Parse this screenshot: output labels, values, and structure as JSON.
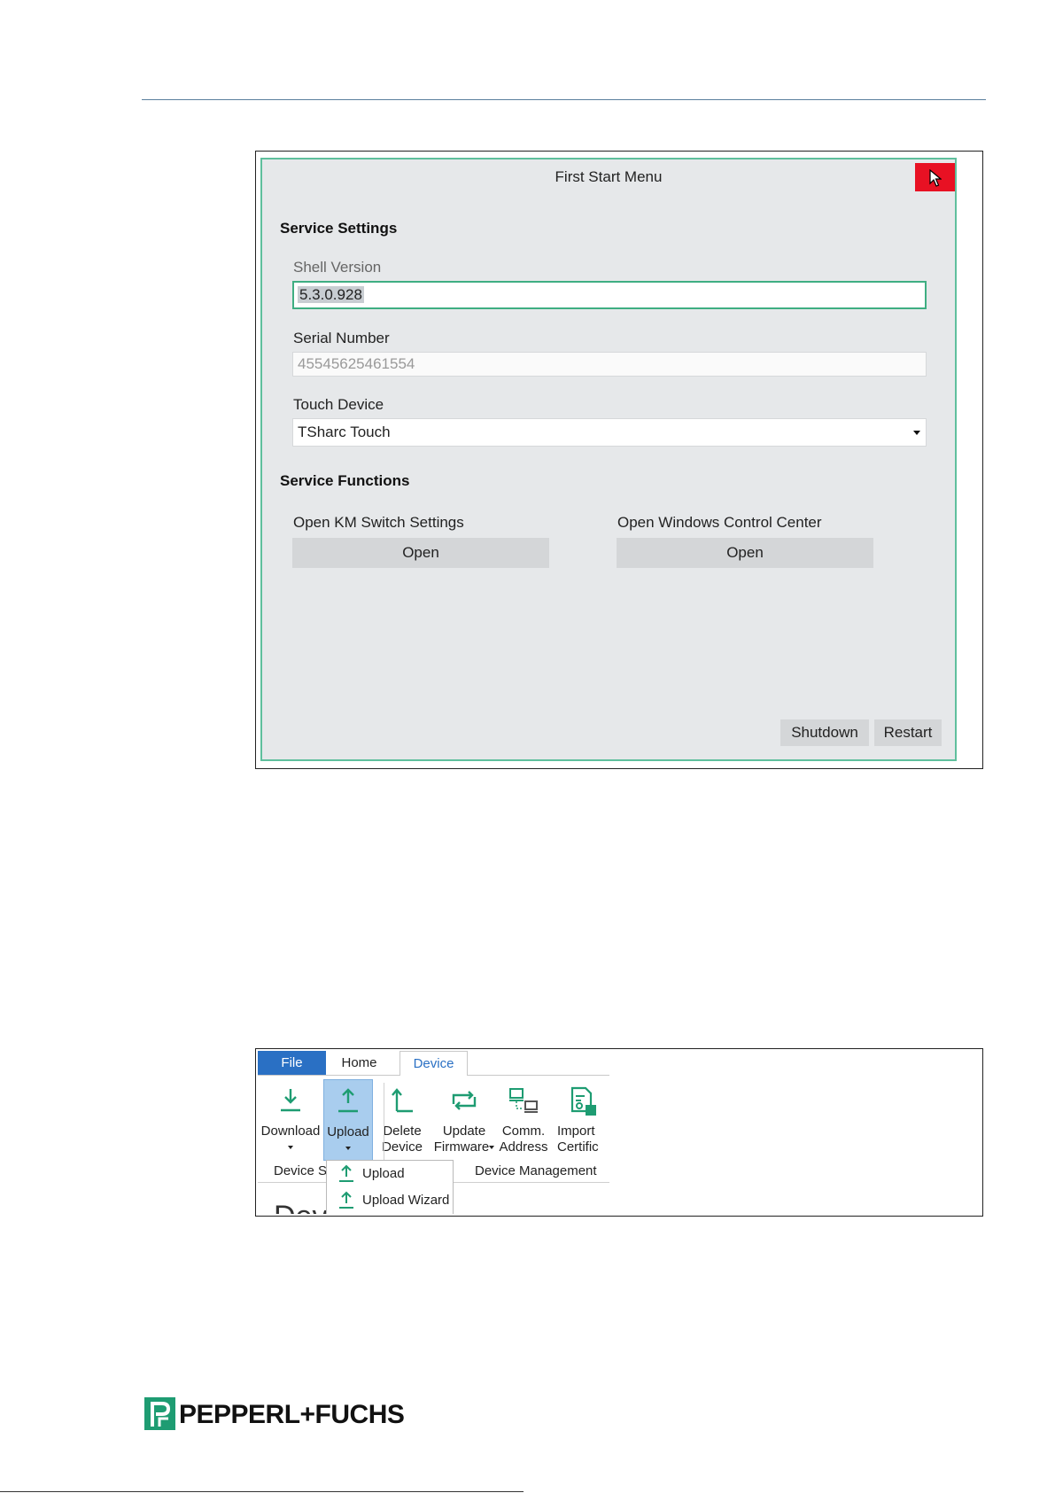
{
  "first_start_menu": {
    "title": "First Start Menu",
    "service_settings": {
      "heading": "Service Settings",
      "shell_version": {
        "label": "Shell Version",
        "value": "5.3.0.928"
      },
      "serial_number": {
        "label": "Serial Number",
        "value": "45545625461554"
      },
      "touch_device": {
        "label": "Touch Device",
        "value": "TSharc Touch"
      }
    },
    "service_functions": {
      "heading": "Service Functions",
      "km_switch": {
        "label": "Open KM Switch Settings",
        "button": "Open"
      },
      "windows_cc": {
        "label": "Open Windows Control Center",
        "button": "Open"
      }
    },
    "shutdown_label": "Shutdown",
    "restart_label": "Restart"
  },
  "ribbon": {
    "tabs": {
      "file": "File",
      "home": "Home",
      "device": "Device"
    },
    "buttons": {
      "download": "Download",
      "upload": "Upload",
      "delete_line1": "Delete",
      "delete_line2": "Device",
      "update_line1": "Update",
      "update_line2": "Firmware",
      "comm_line1": "Comm.",
      "comm_line2": "Address",
      "import_line1": "Import",
      "import_line2": "Certific"
    },
    "groups": {
      "device_settings": "Device Se",
      "device_management": "Device Management"
    },
    "upload_menu": [
      "Upload",
      "Upload Wizard"
    ],
    "partial_heading": "Devi"
  },
  "logo": {
    "text": "PEPPERL+FUCHS",
    "accent": "#1e9c72"
  },
  "colors": {
    "accent_green": "#3fae82",
    "close_red": "#e81123",
    "file_tab_blue": "#2a70c4"
  }
}
